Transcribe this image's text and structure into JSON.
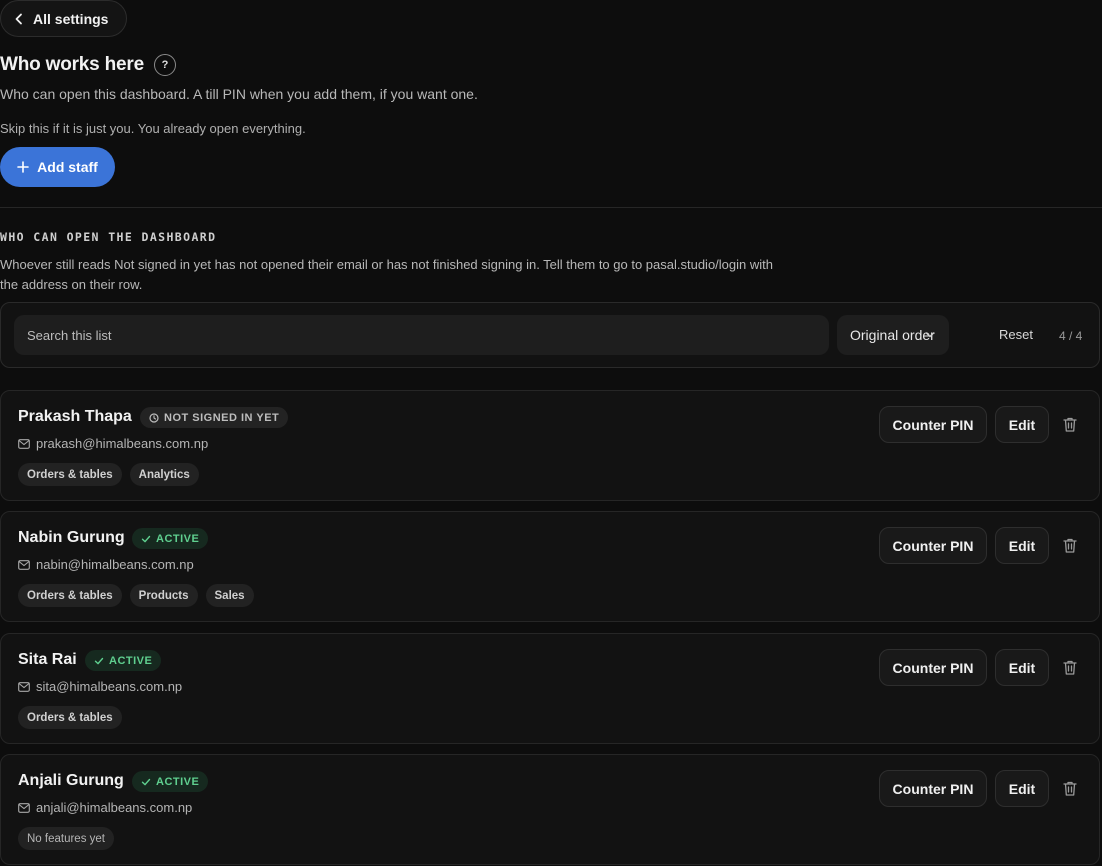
{
  "nav": {
    "back_label": "All settings"
  },
  "header": {
    "title": "Who works here",
    "help": "?",
    "subtitle": "Who can open this dashboard. A till PIN when you add them, if you want one.",
    "skip_note": "Skip this if it is just you. You already open everything.",
    "add_label": "Add staff"
  },
  "section": {
    "label": "WHO CAN OPEN THE DASHBOARD",
    "description": "Whoever still reads Not signed in yet has not opened their email or has not finished signing in. Tell them to go to pasal.studio/login with the address on their row."
  },
  "toolbar": {
    "search_placeholder": "Search this list",
    "sort_value": "Original order",
    "reset_label": "Reset",
    "count": "4 / 4"
  },
  "actions": {
    "pin_label": "Counter PIN",
    "edit_label": "Edit"
  },
  "staff": [
    {
      "name": "Prakash Thapa",
      "status": "NOT SIGNED IN YET",
      "email": "prakash@himalbeans.com.np",
      "tags": [
        "Orders & tables",
        "Analytics"
      ]
    },
    {
      "name": "Nabin Gurung",
      "status": "ACTIVE",
      "email": "nabin@himalbeans.com.np",
      "tags": [
        "Orders & tables",
        "Products",
        "Sales"
      ]
    },
    {
      "name": "Sita Rai",
      "status": "ACTIVE",
      "email": "sita@himalbeans.com.np",
      "tags": [
        "Orders & tables"
      ]
    },
    {
      "name": "Anjali Gurung",
      "status": "ACTIVE",
      "email": "anjali@himalbeans.com.np",
      "tags": [
        "No features yet"
      ]
    }
  ],
  "colors": {
    "accent": "#3b74d8",
    "active_status": "#5fcf8f",
    "background": "#0d0d0d"
  }
}
